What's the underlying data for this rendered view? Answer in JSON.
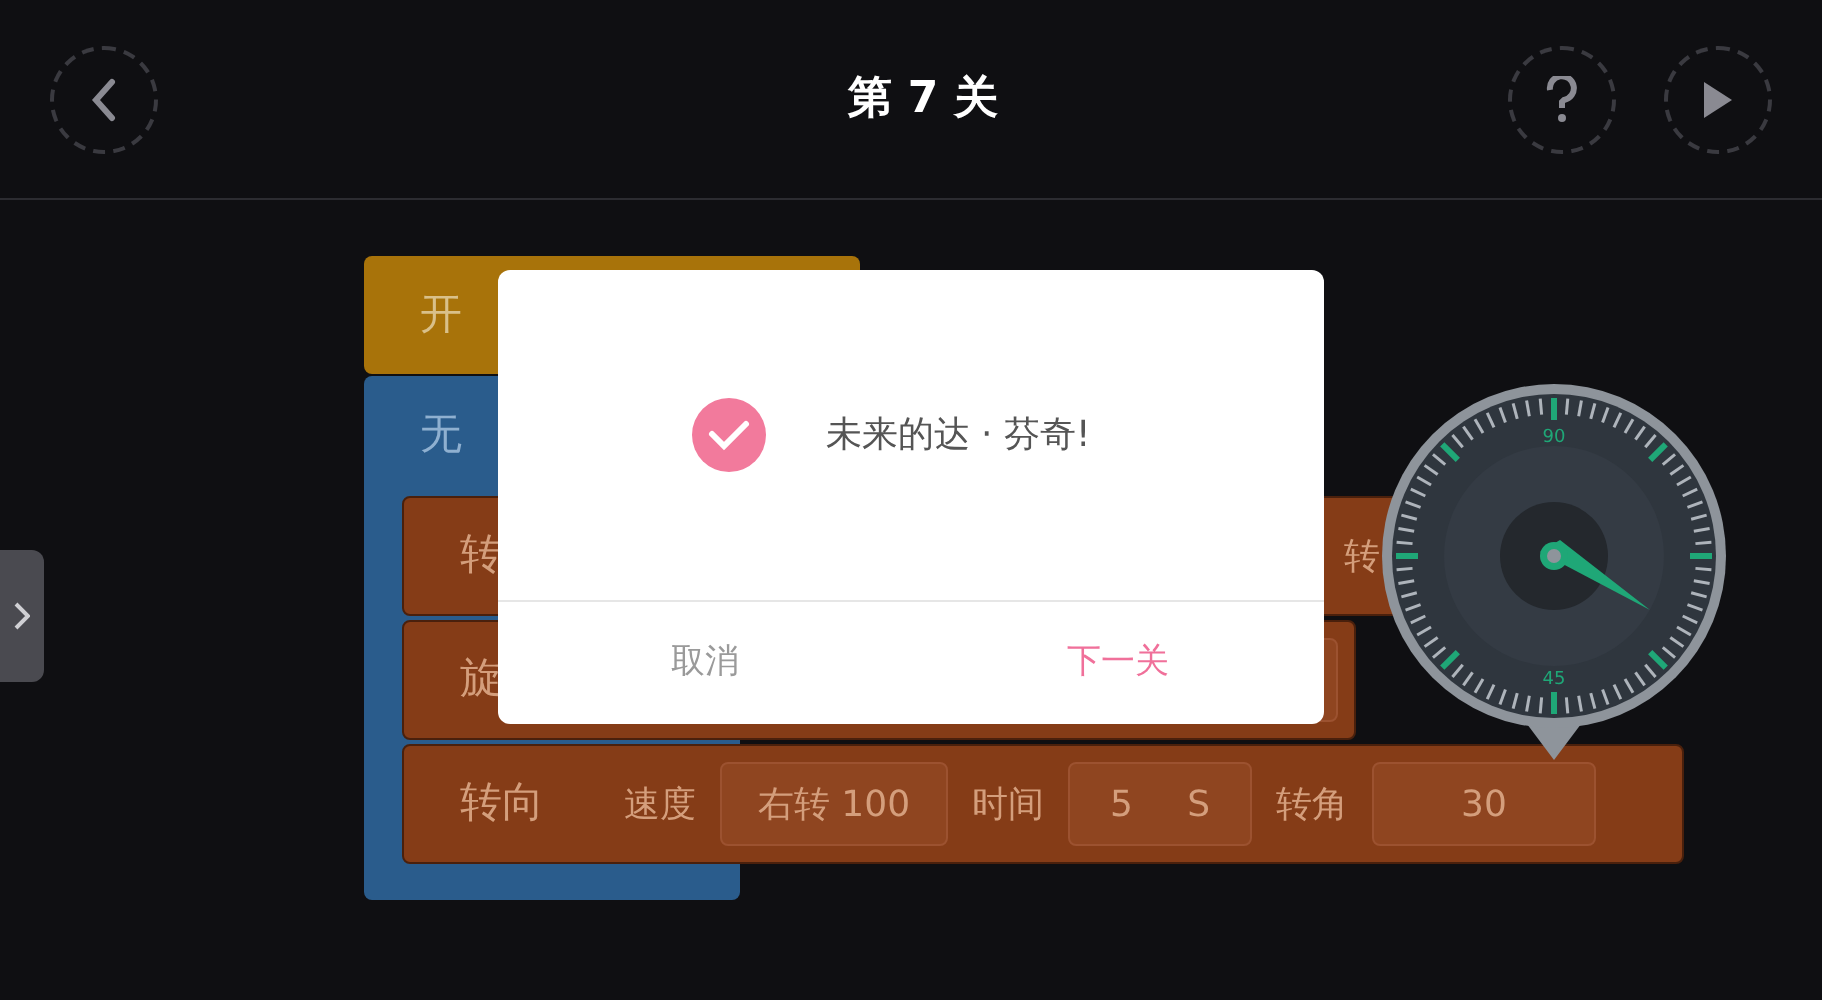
{
  "header": {
    "title": "第 7 关"
  },
  "blocks": {
    "start": {
      "label": "开"
    },
    "loop": {
      "label": "无"
    },
    "rows": [
      {
        "label": "转",
        "items": [
          {
            "kind": "label",
            "text": "转"
          }
        ]
      },
      {
        "label": "旋",
        "items": [
          {
            "kind": "slot"
          }
        ]
      },
      {
        "label": "转向",
        "items": [
          {
            "kind": "label",
            "text": "速度"
          },
          {
            "kind": "field",
            "value": "右转 100"
          },
          {
            "kind": "label",
            "text": "时间"
          },
          {
            "kind": "field",
            "value": "5",
            "unit": "S"
          },
          {
            "kind": "label",
            "text": "转角"
          },
          {
            "kind": "field",
            "value": "30"
          }
        ]
      }
    ]
  },
  "dial": {
    "labels": [
      "90",
      "45"
    ]
  },
  "dialog": {
    "message": "未来的达 · 芬奇!",
    "buttons": [
      {
        "kind": "cancel",
        "label": "取消"
      },
      {
        "kind": "primary",
        "label": "下一关"
      }
    ]
  }
}
